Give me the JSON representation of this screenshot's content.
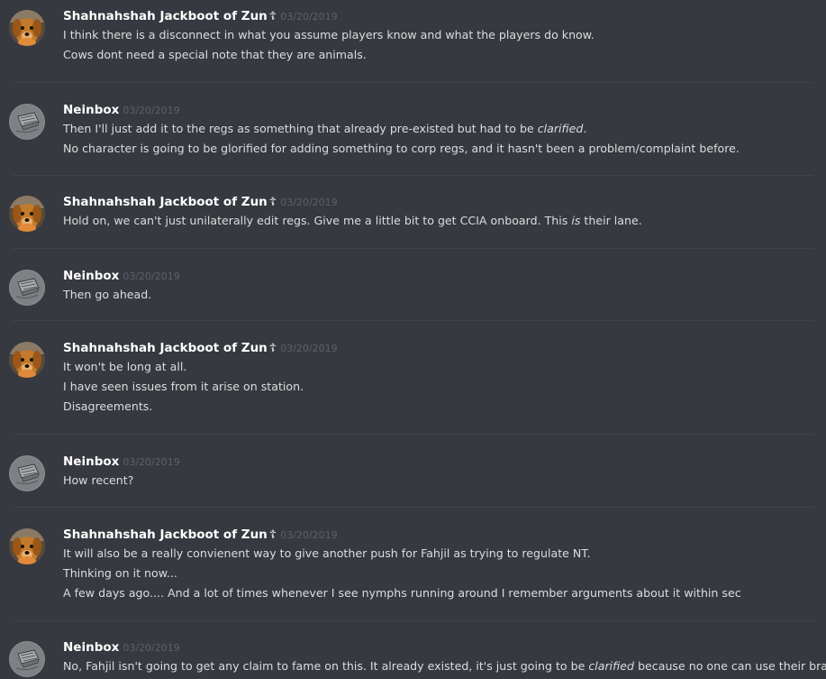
{
  "messages": [
    {
      "author": "Shahnahshah Jackboot of Zun",
      "badge": "☦",
      "timestamp": "03/20/2019",
      "avatar": "dog-avatar",
      "lines": [
        [
          {
            "t": "I think there is a disconnect in what you assume players know and what the players do know."
          }
        ],
        [
          {
            "t": "Cows dont need a special note that they are animals."
          }
        ]
      ]
    },
    {
      "author": "Neinbox",
      "badge": "",
      "timestamp": "03/20/2019",
      "avatar": "sketch-avatar",
      "lines": [
        [
          {
            "t": "Then I'll just add it to the regs as something that already pre-existed but had to be "
          },
          {
            "t": "clarified",
            "i": true
          },
          {
            "t": "."
          }
        ],
        [
          {
            "t": "No character is going to be glorified for adding something to corp regs, and it hasn't been a problem/complaint before."
          }
        ]
      ]
    },
    {
      "author": "Shahnahshah Jackboot of Zun",
      "badge": "☦",
      "timestamp": "03/20/2019",
      "avatar": "dog-avatar",
      "lines": [
        [
          {
            "t": "Hold on, we can't just unilaterally edit regs. Give me a little bit to get CCIA onboard. This "
          },
          {
            "t": "is",
            "i": true
          },
          {
            "t": " their lane."
          }
        ]
      ]
    },
    {
      "author": "Neinbox",
      "badge": "",
      "timestamp": "03/20/2019",
      "avatar": "sketch-avatar",
      "lines": [
        [
          {
            "t": "Then go ahead."
          }
        ]
      ]
    },
    {
      "author": "Shahnahshah Jackboot of Zun",
      "badge": "☦",
      "timestamp": "03/20/2019",
      "avatar": "dog-avatar",
      "lines": [
        [
          {
            "t": "It won't be long at all."
          }
        ],
        [
          {
            "t": "I have seen issues from it arise on station."
          }
        ],
        [
          {
            "t": "Disagreements."
          }
        ]
      ]
    },
    {
      "author": "Neinbox",
      "badge": "",
      "timestamp": "03/20/2019",
      "avatar": "sketch-avatar",
      "lines": [
        [
          {
            "t": "How recent?"
          }
        ]
      ]
    },
    {
      "author": "Shahnahshah Jackboot of Zun",
      "badge": "☦",
      "timestamp": "03/20/2019",
      "avatar": "dog-avatar",
      "lines": [
        [
          {
            "t": "It will also be a really convienent way to give another push for Fahjil as trying to regulate NT."
          }
        ],
        [
          {
            "t": "Thinking on it now..."
          }
        ],
        [
          {
            "t": "A few days ago.... And a lot of times whenever I see nymphs running around I remember arguments about it within sec"
          }
        ]
      ]
    },
    {
      "author": "Neinbox",
      "badge": "",
      "timestamp": "03/20/2019",
      "avatar": "sketch-avatar",
      "lines": [
        [
          {
            "t": "No, Fahjil isn't going to get any claim to fame on this. It already existed, it's just going to be "
          },
          {
            "t": "clarified",
            "i": true
          },
          {
            "t": " because no one can use their brains."
          }
        ]
      ]
    }
  ]
}
